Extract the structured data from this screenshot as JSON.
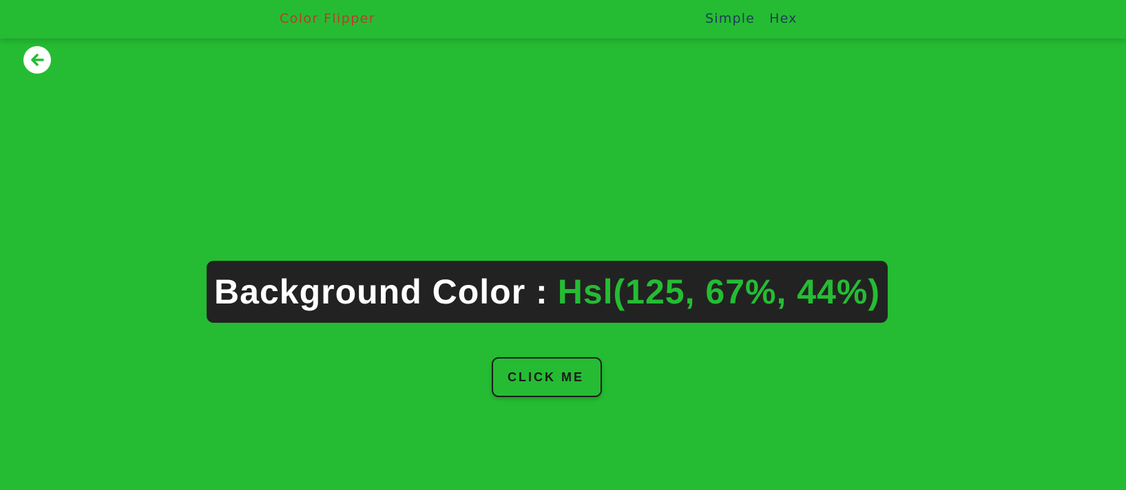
{
  "navbar": {
    "brand": "Color Flipper",
    "links": [
      {
        "label": "Simple"
      },
      {
        "label": "Hex"
      }
    ]
  },
  "back_button": {
    "icon": "arrow-left-circle-icon"
  },
  "banner": {
    "label": "Background Color :",
    "value": "Hsl(125, 67%, 44%)"
  },
  "action_button": {
    "label": "CLICK ME"
  },
  "colors": {
    "background": "#25bc33",
    "brand_text": "#c0392b",
    "nav_link_text": "#1f3b5a",
    "banner_background": "#222222",
    "banner_label": "#ffffff",
    "banner_value": "#25bc33",
    "button_border": "#1d1d1d"
  }
}
